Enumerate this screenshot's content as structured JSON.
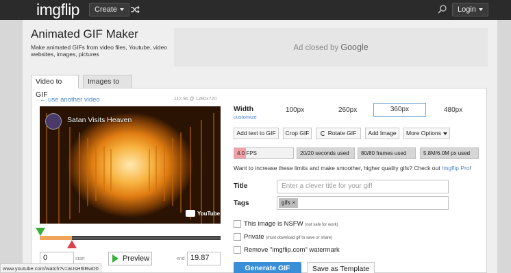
{
  "nav": {
    "logo_part1": "img",
    "logo_part2": "flip",
    "create_label": "Create",
    "login_label": "Login"
  },
  "header": {
    "title": "Animated GIF Maker",
    "subtitle": "Make animated GIFs from video files, Youtube, video websites, images, pictures",
    "ad_text": "Ad closed by ",
    "ad_brand": "Google"
  },
  "tabs": [
    {
      "label": "Video to GIF",
      "active": true
    },
    {
      "label": "Images to GIF",
      "active": false
    }
  ],
  "video_panel": {
    "use_another_label": "← use another video",
    "meta": "112.9s @ 1280x720",
    "video_title": "Satan Visits Heaven",
    "youtube_label": "YouTube",
    "start_value": "0",
    "start_label": "start",
    "preview_label": "Preview",
    "end_label": "end",
    "end_value": "19.87"
  },
  "status_url": "www.youtube.com/watch?v=aUsH6lRwD0",
  "width": {
    "label": "Width",
    "customize_label": "customize",
    "options": [
      "100px",
      "260px",
      "360px",
      "480px"
    ],
    "selected": "360px"
  },
  "toolbar": {
    "add_text": "Add text to GIF",
    "crop": "Crop GIF",
    "rotate": "Rotate GIF",
    "add_image": "Add Image",
    "more_options": "More Options"
  },
  "meters": {
    "fps_label": "4.0 FPS",
    "fps_fraction": 0.2,
    "seconds": "20/20 seconds used",
    "frames": "80/80 frames used",
    "size": "5.8M/6.0M px used",
    "fill_color": "#f1a1a6"
  },
  "upsell": {
    "text": "Want to increase these limits and make smoother, higher quality gifs? Check out ",
    "link": "Imgflip Pro",
    "end": "!"
  },
  "form": {
    "title_label": "Title",
    "title_placeholder": "Enter a clever title for your gif!",
    "tags_label": "Tags",
    "tag_chip": "gifs",
    "tag_remove": "×"
  },
  "options": {
    "nsfw_label": "This image is NSFW",
    "nsfw_note": "(not safe for work)",
    "private_label": "Private",
    "private_note": "(must download gif to save or share)",
    "watermark_label": "Remove \"imgflip.com\" watermark"
  },
  "actions": {
    "generate": "Generate GIF",
    "template": "Save as Template"
  },
  "colors": {
    "accent_blue": "#3a8ed8",
    "link_blue": "#4a86c7",
    "start_marker": "#3cae3c",
    "end_marker": "#d9434b",
    "topbar": "#2b2b2b"
  }
}
